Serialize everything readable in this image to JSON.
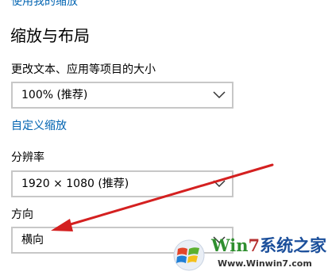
{
  "top_link": {
    "label": "使用我的缩放"
  },
  "section": {
    "title": "缩放与布局"
  },
  "scale": {
    "label": "更改文本、应用等项目的大小",
    "value": "100% (推荐)"
  },
  "custom_scaling": {
    "label": "自定义缩放"
  },
  "resolution": {
    "label": "分辨率",
    "value": "1920 × 1080 (推荐)"
  },
  "orientation": {
    "label": "方向",
    "value": "横向"
  },
  "annotation": {
    "arrow_color": "#d42020"
  },
  "watermark": {
    "title_part1": "Win",
    "title_part2": "7",
    "title_part3": "系统之家",
    "url": "Www.Winwin7.com"
  },
  "colors": {
    "link": "#0063b1",
    "border": "#c7c7c7",
    "background": "#ffffff"
  }
}
